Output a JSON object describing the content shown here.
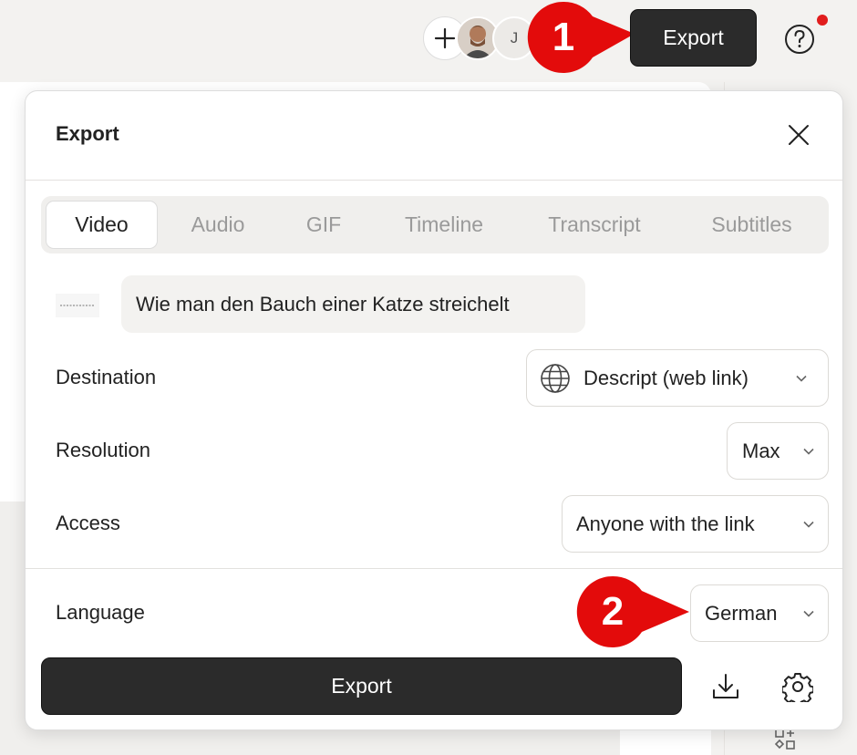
{
  "topbar": {
    "add_icon": "plus-icon",
    "avatar_initial": "J",
    "export_label": "Export",
    "help_icon": "question-circle-icon",
    "notification_color": "#e11d1d"
  },
  "annotations": {
    "step1": "1",
    "step2": "2",
    "color": "#e30b0b"
  },
  "modal": {
    "title": "Export",
    "close_icon": "close-icon",
    "tabs": [
      {
        "label": "Video",
        "active": true
      },
      {
        "label": "Audio",
        "active": false
      },
      {
        "label": "GIF",
        "active": false
      },
      {
        "label": "Timeline",
        "active": false
      },
      {
        "label": "Transcript",
        "active": false
      },
      {
        "label": "Subtitles",
        "active": false
      }
    ],
    "title_value": "Wie man den Bauch einer Katze streichelt",
    "fields": {
      "destination": {
        "label": "Destination",
        "value": "Descript (web link)",
        "icon": "globe-icon"
      },
      "resolution": {
        "label": "Resolution",
        "value": "Max"
      },
      "access": {
        "label": "Access",
        "value": "Anyone with the link"
      },
      "language": {
        "label": "Language",
        "value": "German"
      }
    },
    "export_button": "Export",
    "download_icon": "download-icon",
    "settings_icon": "gear-icon"
  },
  "colors": {
    "dark_button": "#2b2b2b",
    "tab_bg": "#f0efed"
  }
}
